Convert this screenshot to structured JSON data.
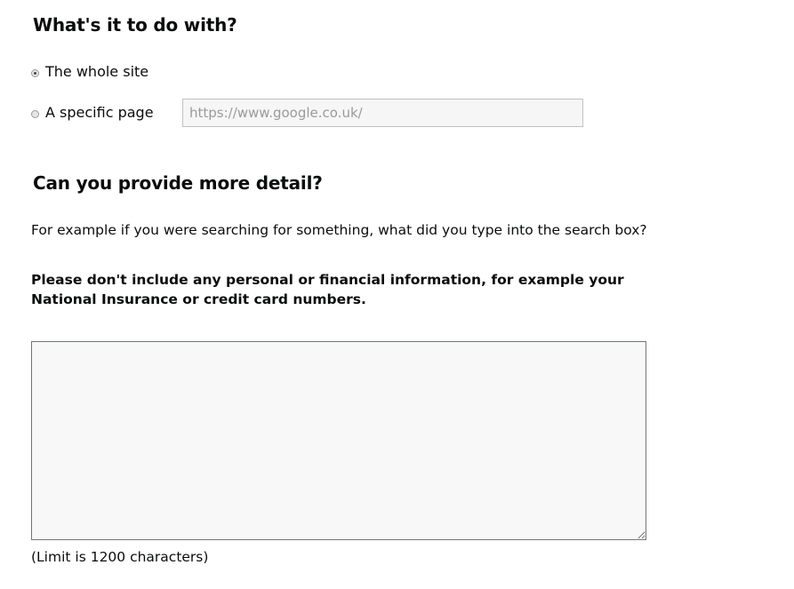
{
  "section_what": {
    "heading": "What's it to do with?",
    "options": [
      {
        "label": "The whole site",
        "checked": true
      },
      {
        "label": "A specific page",
        "checked": false
      }
    ],
    "url_input": {
      "value": "",
      "placeholder": "https://www.google.co.uk/"
    }
  },
  "section_detail": {
    "heading": "Can you provide more detail?",
    "hint": "For example if you were searching for something, what did you type into the search box?",
    "warning": "Please don't include any personal or financial information, for example your National Insurance or credit card numbers.",
    "textarea_value": "",
    "limit_text": "(Limit is 1200 characters)"
  }
}
